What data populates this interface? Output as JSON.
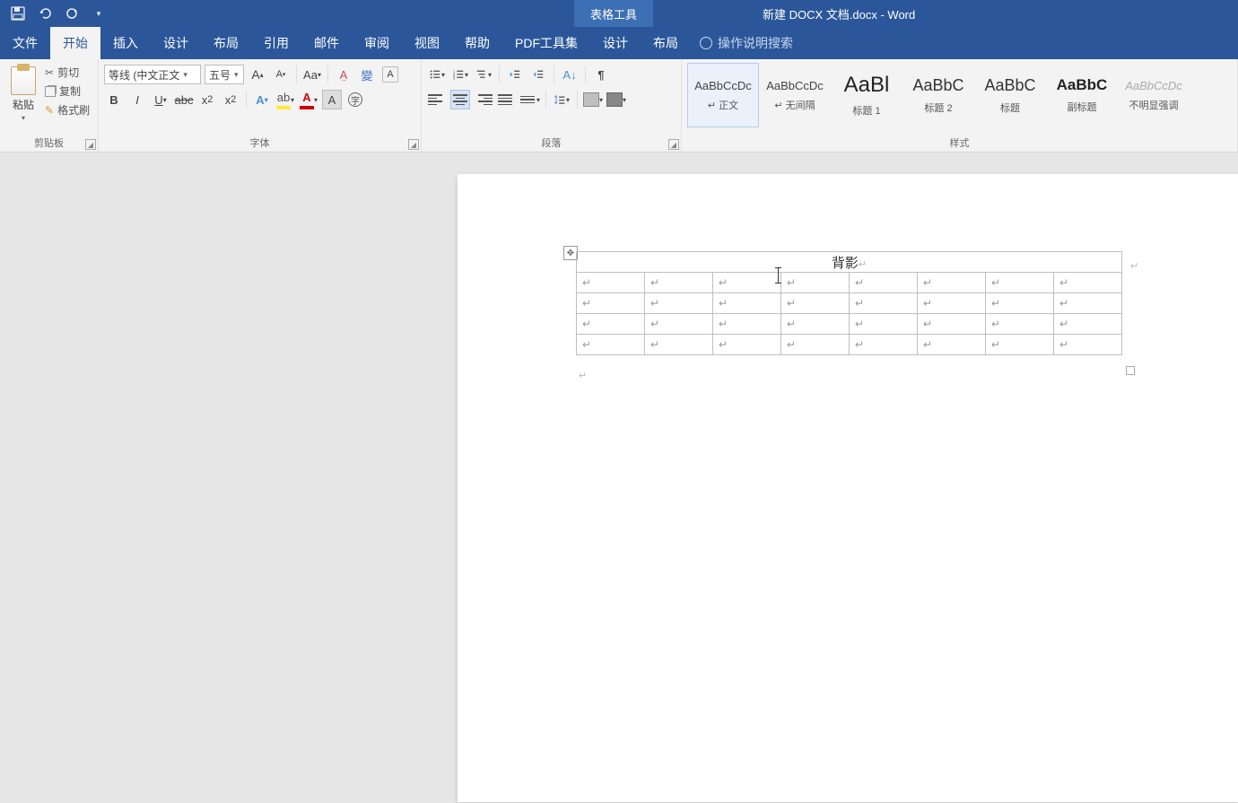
{
  "titlebar": {
    "table_tools": "表格工具",
    "doc_title": "新建 DOCX 文档.docx - Word"
  },
  "tabs": {
    "file": "文件",
    "home": "开始",
    "insert": "插入",
    "design": "设计",
    "layout": "布局",
    "references": "引用",
    "mailings": "邮件",
    "review": "审阅",
    "view": "视图",
    "help": "帮助",
    "pdf": "PDF工具集",
    "table_design": "设计",
    "table_layout": "布局",
    "tell_me": "操作说明搜索"
  },
  "clipboard": {
    "paste": "粘贴",
    "cut": "剪切",
    "copy": "复制",
    "format_painter": "格式刷",
    "group": "剪贴板"
  },
  "font": {
    "name": "等线 (中文正文",
    "size": "五号",
    "group": "字体"
  },
  "paragraph": {
    "group": "段落"
  },
  "styles": {
    "group": "样式",
    "items": [
      {
        "preview": "AaBbCcDc",
        "name": "↵ 正文"
      },
      {
        "preview": "AaBbCcDc",
        "name": "↵ 无间隔"
      },
      {
        "preview": "AaBl",
        "name": "标题 1"
      },
      {
        "preview": "AaBbC",
        "name": "标题 2"
      },
      {
        "preview": "AaBbC",
        "name": "标题"
      },
      {
        "preview": "AaBbC",
        "name": "副标题"
      },
      {
        "preview": "AaBbCcDc",
        "name": "不明显强调"
      }
    ]
  },
  "document": {
    "table_title": "背影",
    "rows": 4,
    "cols": 8
  }
}
